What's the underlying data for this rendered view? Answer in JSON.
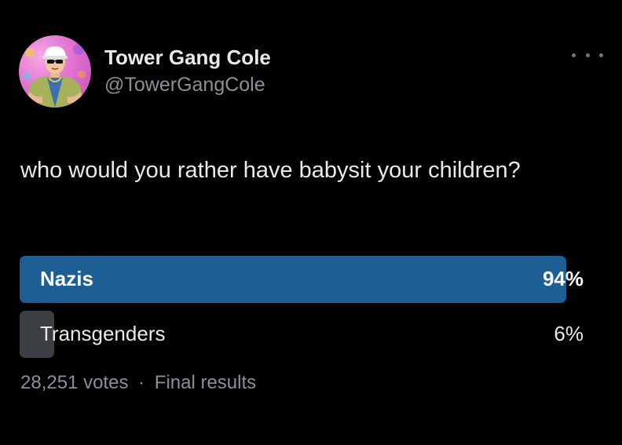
{
  "author": {
    "display_name": "Tower Gang Cole",
    "handle": "@TowerGangCole",
    "avatar_icon": "cartoon-avatar-icon"
  },
  "tweet": {
    "text": "who would you rather have babysit your children?"
  },
  "poll": {
    "options": [
      {
        "label": "Nazis",
        "percent": "94%",
        "share": 0.94,
        "winner": true,
        "bar_color": "#1d5f95"
      },
      {
        "label": "Transgenders",
        "percent": "6%",
        "share": 0.06,
        "winner": false,
        "bar_color": "#3b3e42"
      }
    ],
    "votes": "28,251 votes",
    "separator": "·",
    "status": "Final results"
  },
  "menu": {
    "icon": "more-options-icon"
  }
}
